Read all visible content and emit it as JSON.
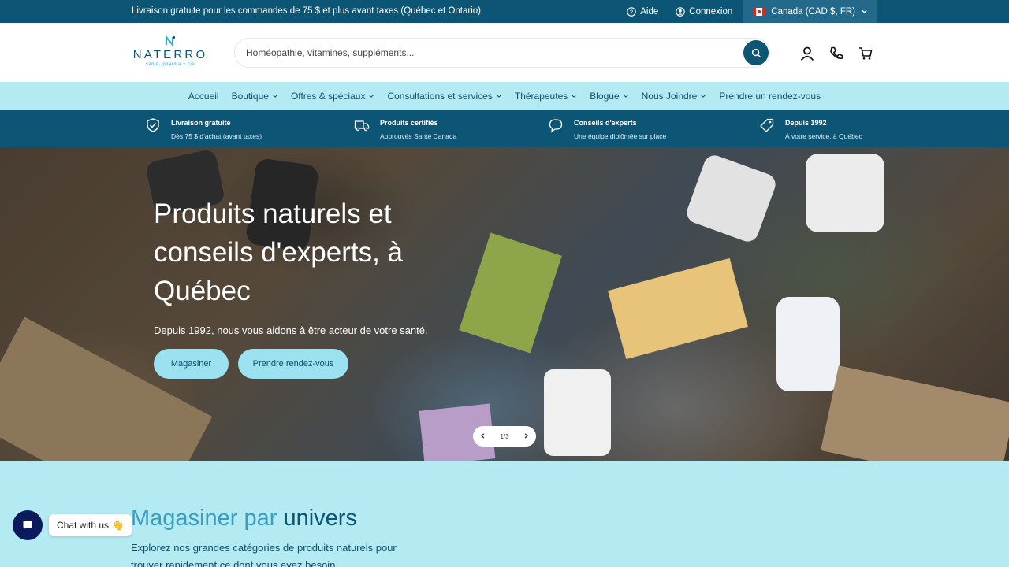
{
  "topbar": {
    "announcement": "Livraison gratuite pour les commandes de 75 $ et plus avant taxes (Québec et Ontario)",
    "help": "Aide",
    "login": "Connexion",
    "country": "Canada (CAD $, FR)"
  },
  "header": {
    "logo_name": "NATERRO",
    "logo_tagline": "santé, pharma + cie",
    "search_placeholder": "Homéopathie, vitamines, suppléments..."
  },
  "nav": {
    "items": [
      {
        "label": "Accueil",
        "has_dropdown": false
      },
      {
        "label": "Boutique",
        "has_dropdown": true
      },
      {
        "label": "Offres & spéciaux",
        "has_dropdown": true
      },
      {
        "label": "Consultations et services",
        "has_dropdown": true
      },
      {
        "label": "Thérapeutes",
        "has_dropdown": true
      },
      {
        "label": "Blogue",
        "has_dropdown": true
      },
      {
        "label": "Nous Joindre",
        "has_dropdown": true
      },
      {
        "label": "Prendre un rendez-vous",
        "has_dropdown": false
      }
    ]
  },
  "benefits": [
    {
      "icon": "shield-check-icon",
      "title": "Livraison gratuite",
      "subtitle": "Dès 75 $ d'achat (avant taxes)"
    },
    {
      "icon": "truck-icon",
      "title": "Produits certifiés",
      "subtitle": "Approuvés Santé Canada"
    },
    {
      "icon": "chat-icon",
      "title": "Conseils d'experts",
      "subtitle": "Une équipe diplômée sur place"
    },
    {
      "icon": "tag-icon",
      "title": "Depuis 1992",
      "subtitle": "À votre service, à Québec"
    }
  ],
  "hero": {
    "title": "Produits naturels et conseils d'experts, à Québec",
    "subtitle": "Depuis 1992, nous vous aidons à être acteur de votre santé.",
    "btn_shop": "Magasiner",
    "btn_rdv": "Prendre rendez-vous",
    "slide_counter": "1/3"
  },
  "section": {
    "title_part1": "Magasiner par",
    "title_part2": "univers",
    "description": "Explorez nos grandes catégories de produits naturels pour trouver rapidement ce dont vous avez besoin."
  },
  "chat": {
    "label": "Chat with us",
    "emoji": "👋"
  },
  "colors": {
    "primary": "#0d5574",
    "accent_light": "#b4eaf2",
    "button": "#9be1ef",
    "title_light": "#3a9fbe",
    "chat_bubble": "#0a1a5c"
  }
}
